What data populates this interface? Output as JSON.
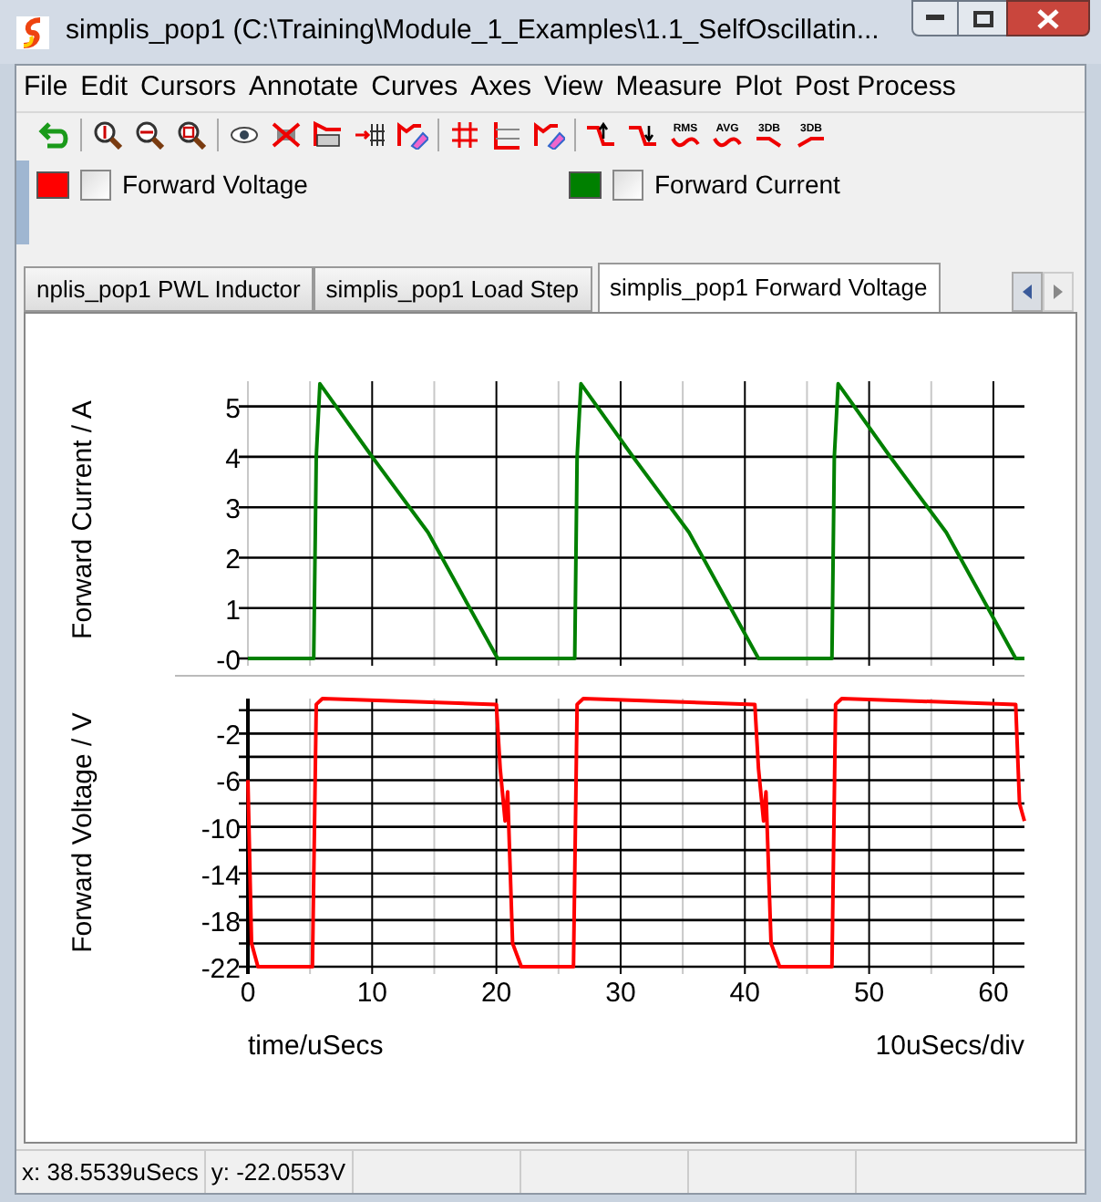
{
  "window": {
    "title": "simplis_pop1 (C:\\Training\\Module_1_Examples\\1.1_SelfOscillatin..."
  },
  "menu": [
    "File",
    "Edit",
    "Cursors",
    "Annotate",
    "Curves",
    "Axes",
    "View",
    "Measure",
    "Plot",
    "Post Process"
  ],
  "toolbar": {
    "measure_labels": [
      "RMS",
      "AVG",
      "3DB",
      "3DB"
    ]
  },
  "legend": [
    {
      "label": "Forward Voltage",
      "color": "#ff0000",
      "checked": false
    },
    {
      "label": "Forward Current",
      "color": "#008000",
      "checked": false
    }
  ],
  "tabs": [
    {
      "label": "nplis_pop1 PWL Inductor",
      "selected": false
    },
    {
      "label": "simplis_pop1 Load Step",
      "selected": false
    },
    {
      "label": "simplis_pop1 Forward Voltage",
      "selected": true
    }
  ],
  "plots": [
    {
      "chart_data": {
        "type": "line",
        "grid": true,
        "ylabel": "Forward Current / A",
        "xlim": [
          0,
          62.5
        ],
        "ylim": [
          0,
          5.5
        ],
        "yticks": [
          {
            "value": 0,
            "label": "-0"
          },
          1,
          2,
          3,
          4,
          5
        ],
        "x": [
          0,
          5.3,
          5.5,
          5.8,
          10,
          14.5,
          20.1,
          26.3,
          26.5,
          26.8,
          31,
          35.5,
          41.1,
          47.0,
          47.2,
          47.5,
          51.7,
          56.2,
          61.8,
          62.5
        ],
        "series": [
          {
            "color": "#008000",
            "values": [
              0,
              0,
              4,
              5.45,
              4,
              2.5,
              0,
              0,
              4,
              5.45,
              4,
              2.5,
              0,
              0,
              4,
              5.45,
              4,
              2.5,
              0,
              0
            ]
          }
        ]
      }
    },
    {
      "chart_data": {
        "type": "line",
        "grid": true,
        "ylabel": "Forward Voltage / V",
        "xlabel": "time/uSecs",
        "xlim": [
          0,
          62.5
        ],
        "ylim": [
          -22,
          1
        ],
        "xticks": [
          0,
          10,
          20,
          30,
          40,
          50,
          60
        ],
        "yticks": [
          -22,
          -18,
          -14,
          -10,
          -6,
          -2
        ],
        "x": [
          0,
          0.3,
          0.8,
          5.2,
          5.5,
          6,
          20,
          20.3,
          20.7,
          20.9,
          21.3,
          22,
          26.2,
          26.5,
          27,
          40.8,
          41.1,
          41.5,
          41.7,
          42.1,
          42.8,
          47.0,
          47.3,
          47.8,
          61.8,
          62.1,
          62.5
        ],
        "series": [
          {
            "color": "#ff0000",
            "values": [
              -6,
              -20,
              -22,
              -22,
              0.5,
              1,
              0.5,
              -5,
              -9.5,
              -7,
              -20,
              -22,
              -22,
              0.5,
              1,
              0.5,
              -5,
              -9.5,
              -7,
              -20,
              -22,
              -22,
              0.5,
              1,
              0.5,
              -8,
              -9.5
            ]
          }
        ]
      }
    }
  ],
  "scale_label": "10uSecs/div",
  "status_bar": [
    "x: 38.5539uSecs",
    "y: -22.0553V"
  ]
}
